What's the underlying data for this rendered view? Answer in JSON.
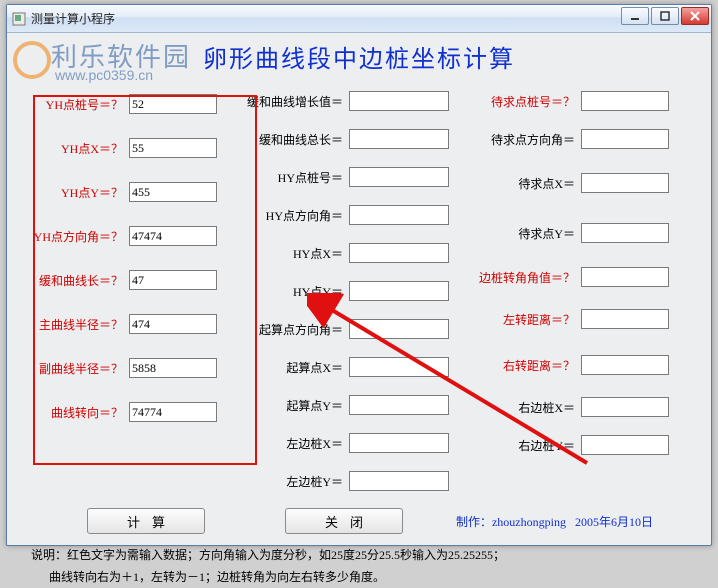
{
  "window": {
    "title": "测量计算小程序"
  },
  "page_title": "卵形曲线段中边桩坐标计算",
  "watermark": {
    "text": "利乐软件园",
    "url": "www.pc0359.cn"
  },
  "col1": {
    "rows": [
      {
        "label": "YH点桩号＝？",
        "value": "52"
      },
      {
        "label": "YH点X＝？",
        "value": "55"
      },
      {
        "label": "YH点Y＝？",
        "value": "455"
      },
      {
        "label": "YH点方向角＝？",
        "value": "47474"
      },
      {
        "label": "缓和曲线长＝？",
        "value": "47"
      },
      {
        "label": "主曲线半径＝？",
        "value": "474"
      },
      {
        "label": "副曲线半径＝？",
        "value": "5858"
      },
      {
        "label": "曲线转向＝？",
        "value": "74774"
      }
    ]
  },
  "col2": {
    "rows": [
      {
        "label": "缓和曲线增长值＝",
        "value": ""
      },
      {
        "label": "缓和曲线总长＝",
        "value": ""
      },
      {
        "label": "HY点桩号＝",
        "value": ""
      },
      {
        "label": "HY点方向角＝",
        "value": ""
      },
      {
        "label": "HY点X＝",
        "value": ""
      },
      {
        "label": "HY点Y＝",
        "value": ""
      },
      {
        "label": "起算点方向角＝",
        "value": ""
      },
      {
        "label": "起算点X＝",
        "value": ""
      },
      {
        "label": "起算点Y＝",
        "value": ""
      },
      {
        "label": "左边桩X＝",
        "value": ""
      },
      {
        "label": "左边桩Y＝",
        "value": ""
      }
    ]
  },
  "col3": {
    "rows": [
      {
        "label_red": "待求点桩号＝？",
        "value": "",
        "space": 0
      },
      {
        "label": "待求点方向角＝",
        "value": "",
        "space": 0
      },
      {
        "label": "待求点X＝",
        "value": "",
        "space": 14
      },
      {
        "label": "待求点Y＝",
        "value": "",
        "space": 14
      },
      {
        "label_red": "边桩转角角值＝？",
        "value": "",
        "space": 0
      },
      {
        "label_red": "左转距离＝？",
        "value": "",
        "space": 14
      },
      {
        "label_red": "右转距离＝？",
        "value": "",
        "space": 14
      },
      {
        "label": "右边桩X＝",
        "value": "",
        "space": 0
      },
      {
        "label": "右边桩Y＝",
        "value": "",
        "space": 0
      }
    ]
  },
  "buttons": {
    "calc": "计算",
    "close": "关闭"
  },
  "credit": {
    "author_label": "制作：",
    "author": "zhouzhongping",
    "date": "2005年6月10日"
  },
  "notes": {
    "prefix": "说明：",
    "line1": "红色文字为需输入数据；方向角输入为度分秒，如25度25分25.5秒输入为25.25255；",
    "line2": "曲线转向右为＋1，左转为－1；边桩转角为向左右转多少角度。"
  }
}
